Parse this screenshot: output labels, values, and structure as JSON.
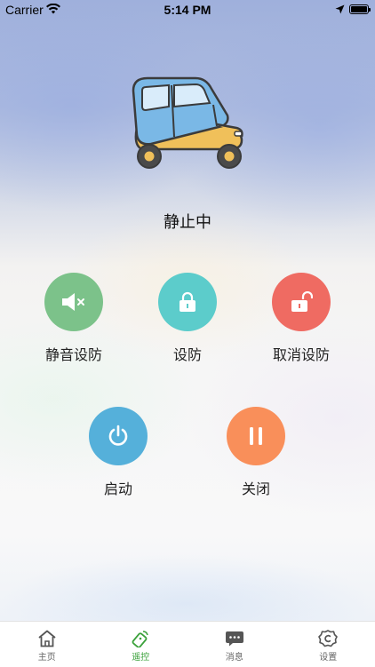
{
  "status_bar": {
    "carrier": "Carrier",
    "time": "5:14 PM"
  },
  "vehicle": {
    "state": "静止中"
  },
  "actions": [
    {
      "label": "静音设防",
      "color": "#7cc28a",
      "icon": "speaker-mute-icon"
    },
    {
      "label": "设防",
      "color": "#5ccccb",
      "icon": "lock-closed-icon"
    },
    {
      "label": "取消设防",
      "color": "#ef6b62",
      "icon": "lock-open-icon"
    },
    {
      "label": "启动",
      "color": "#55b0da",
      "icon": "power-icon"
    },
    {
      "label": "关闭",
      "color": "#f98f5a",
      "icon": "pause-icon"
    }
  ],
  "tabs": [
    {
      "label": "主页",
      "icon": "home-icon",
      "active": false
    },
    {
      "label": "遥控",
      "icon": "remote-key-icon",
      "active": true
    },
    {
      "label": "消息",
      "icon": "message-icon",
      "active": false
    },
    {
      "label": "设置",
      "icon": "settings-icon",
      "active": false
    }
  ],
  "colors": {
    "tab_active": "#3aa13a",
    "tab_inactive": "#666666"
  }
}
